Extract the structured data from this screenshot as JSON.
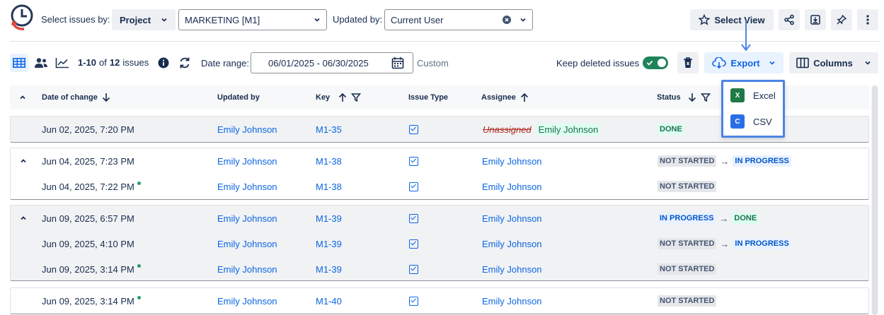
{
  "toolbar": {
    "select_issues_by_label": "Select issues by:",
    "project_button": "Project",
    "project_value": "MARKETING [M1]",
    "updated_by_label": "Updated by:",
    "updated_by_value": "Current User",
    "select_view": "Select View"
  },
  "subbar": {
    "count_range": "1-10",
    "count_of": "of",
    "count_total": "12",
    "count_suffix": "issues",
    "date_range_label": "Date range:",
    "date_range_value": "06/01/2025 - 06/30/2025",
    "date_mode": "Custom",
    "keep_deleted_label": "Keep deleted issues",
    "keep_deleted_on": true,
    "export_label": "Export",
    "columns_label": "Columns"
  },
  "export_menu": {
    "items": [
      {
        "label": "Excel",
        "icon_letter": "X"
      },
      {
        "label": "CSV",
        "icon_letter": "C"
      }
    ]
  },
  "columns": {
    "date": "Date of change",
    "updated_by": "Updated by",
    "key": "Key",
    "issue_type": "Issue Type",
    "assignee": "Assignee",
    "status": "Status"
  },
  "rows": [
    {
      "date": "Jun 02, 2025, 7:20 PM",
      "updated_by": "Emily Johnson",
      "key": "M1-35",
      "assignee_old": "Unassigned",
      "assignee": "Emily Johnson",
      "status_from": "",
      "status_to": "DONE"
    },
    {
      "date": "Jun 04, 2025, 7:23 PM",
      "updated_by": "Emily Johnson",
      "key": "M1-38",
      "assignee": "Emily Johnson",
      "status_from": "NOT STARTED",
      "status_to": "IN PROGRESS"
    },
    {
      "date": "Jun 04, 2025, 7:22 PM",
      "updated_by": "Emily Johnson",
      "key": "M1-38",
      "assignee": "Emily Johnson",
      "status_to": "NOT STARTED"
    },
    {
      "date": "Jun 09, 2025, 6:57 PM",
      "updated_by": "Emily Johnson",
      "key": "M1-39",
      "assignee": "Emily Johnson",
      "status_from": "IN PROGRESS",
      "status_to": "DONE"
    },
    {
      "date": "Jun 09, 2025, 4:10 PM",
      "updated_by": "Emily Johnson",
      "key": "M1-39",
      "assignee": "Emily Johnson",
      "status_from": "NOT STARTED",
      "status_to": "IN PROGRESS"
    },
    {
      "date": "Jun 09, 2025, 3:14 PM",
      "updated_by": "Emily Johnson",
      "key": "M1-39",
      "assignee": "Emily Johnson",
      "status_to": "NOT STARTED"
    },
    {
      "date": "Jun 09, 2025, 3:14 PM",
      "updated_by": "Emily Johnson",
      "key": "M1-40",
      "assignee": "Emily Johnson",
      "status_to": "NOT STARTED"
    }
  ]
}
